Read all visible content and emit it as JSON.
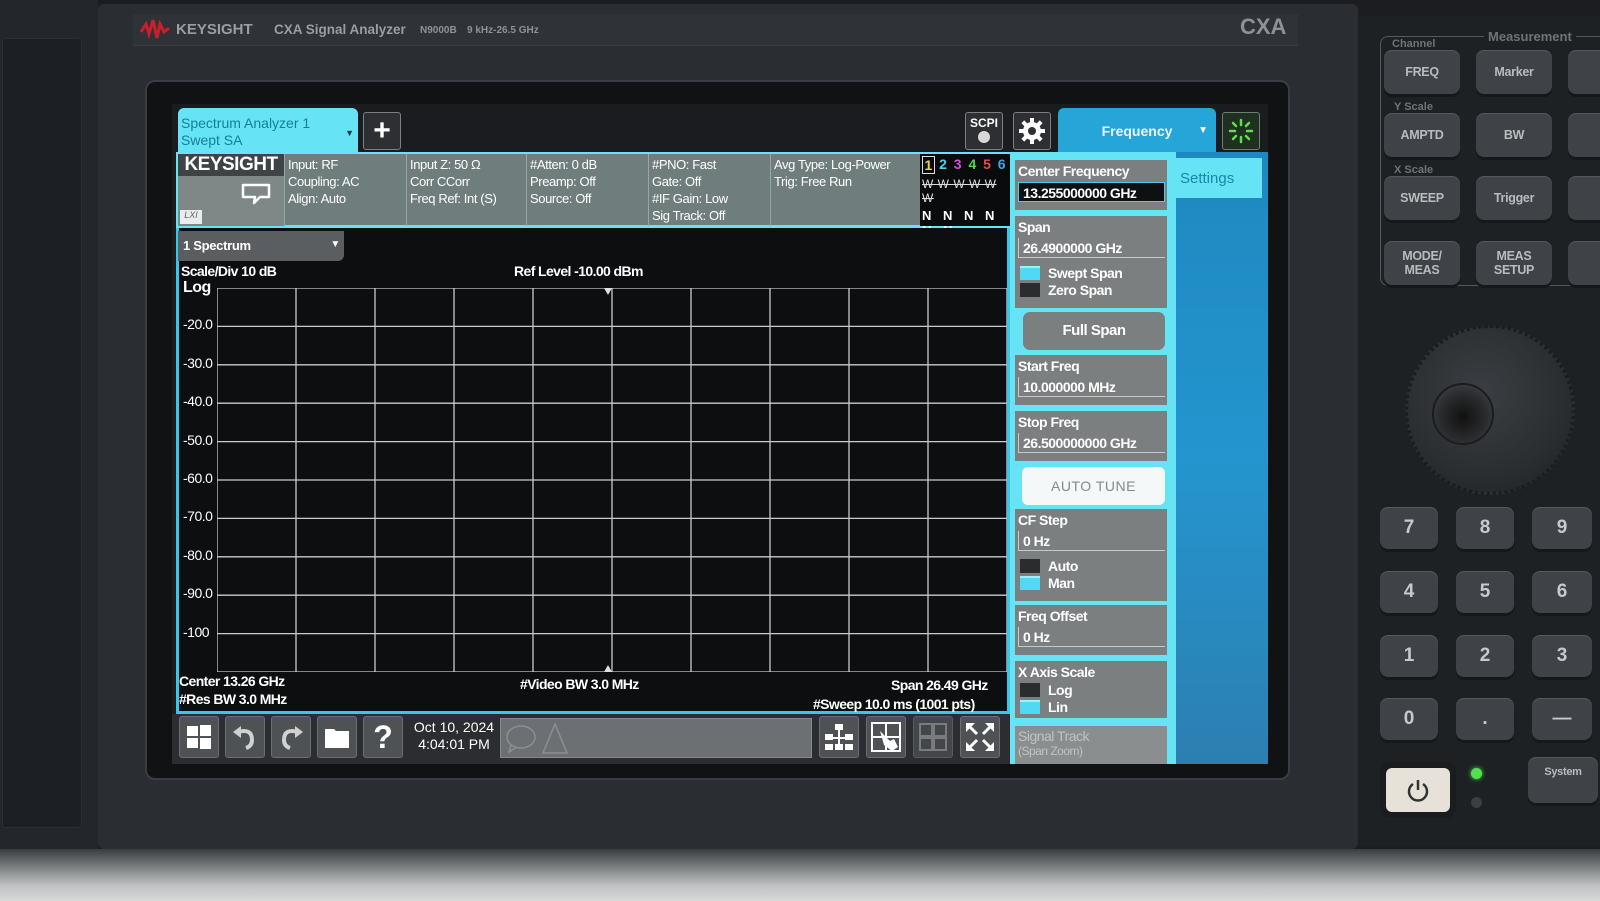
{
  "instrument": {
    "brand": "KEYSIGHT",
    "model_name": "CXA Signal Analyzer",
    "model_number": "N9000B",
    "freq_range": "9 kHz-26.5 GHz",
    "series": "CXA"
  },
  "topbar": {
    "meas_tab_line1": "Spectrum Analyzer 1",
    "meas_tab_line2": "Swept SA",
    "add_label": "+",
    "scpi_label": "SCPI",
    "menu_title": "Frequency",
    "dropdown_glyph": "▼"
  },
  "infobar": {
    "logo": "KEYSIGHT",
    "lxi": "LXI",
    "col1": [
      "Input: RF",
      "Coupling: AC",
      "Align: Auto"
    ],
    "col2": [
      "Input Z: 50 Ω",
      "Corr CCorr",
      "Freq Ref: Int (S)"
    ],
    "col3": [
      "#Atten: 0 dB",
      "Preamp: Off",
      "Source: Off"
    ],
    "col4": [
      "#PNO: Fast",
      "Gate: Off",
      "#IF Gain: Low",
      "Sig Track: Off"
    ],
    "col5": [
      "Avg Type: Log-Power",
      "Trig: Free Run"
    ],
    "traces": {
      "numbers": [
        "1",
        "2",
        "3",
        "4",
        "5",
        "6"
      ],
      "colors": [
        "#e8d449",
        "#4fd3e8",
        "#d650d6",
        "#4fd84f",
        "#e84a4a",
        "#3aa7e8"
      ],
      "types": "W W W W W W",
      "detectors": "N N N N N N"
    }
  },
  "graph": {
    "view": "1 Spectrum",
    "scale_div": "Scale/Div 10 dB",
    "scale_type": "Log",
    "ref_level": "Ref Level -10.00 dBm",
    "y_ticks": [
      "-20.0",
      "-30.0",
      "-40.0",
      "-50.0",
      "-60.0",
      "-70.0",
      "-80.0",
      "-90.0",
      "-100"
    ],
    "center": "Center 13.26 GHz",
    "res_bw": "#Res BW 3.0 MHz",
    "video_bw": "#Video BW 3.0 MHz",
    "span": "Span 26.49 GHz",
    "sweep": "#Sweep 10.0 ms (1001 pts)"
  },
  "taskbar": {
    "date": "Oct 10, 2024",
    "time": "4:04:01 PM"
  },
  "softkeys": {
    "settings_tab": "Settings",
    "center_freq_label": "Center Frequency",
    "center_freq_value": "13.255000000 GHz",
    "span_label": "Span",
    "span_value": "26.4900000 GHz",
    "swept_span": "Swept Span",
    "zero_span": "Zero Span",
    "full_span": "Full Span",
    "start_freq_label": "Start Freq",
    "start_freq_value": "10.000000 MHz",
    "stop_freq_label": "Stop Freq",
    "stop_freq_value": "26.500000000 GHz",
    "auto_tune": "AUTO TUNE",
    "cf_step_label": "CF Step",
    "cf_step_value": "0 Hz",
    "auto": "Auto",
    "man": "Man",
    "freq_offset_label": "Freq Offset",
    "freq_offset_value": "0 Hz",
    "x_axis_label": "X Axis Scale",
    "log": "Log",
    "lin": "Lin",
    "signal_track": "Signal Track",
    "signal_track_sub": "(Span Zoom)"
  },
  "front_panel": {
    "group_label": "Measurement",
    "channel": "Channel",
    "y_scale": "Y Scale",
    "x_scale": "X Scale",
    "keys": [
      "FREQ",
      "Marker",
      "AMPTD",
      "BW",
      "SWEEP",
      "Trigger",
      "MODE/ MEAS",
      "MEAS SETUP"
    ],
    "numpad": [
      "7",
      "8",
      "9",
      "4",
      "5",
      "6",
      "1",
      "2",
      "3",
      "0",
      ".",
      "—"
    ],
    "system": "System"
  }
}
